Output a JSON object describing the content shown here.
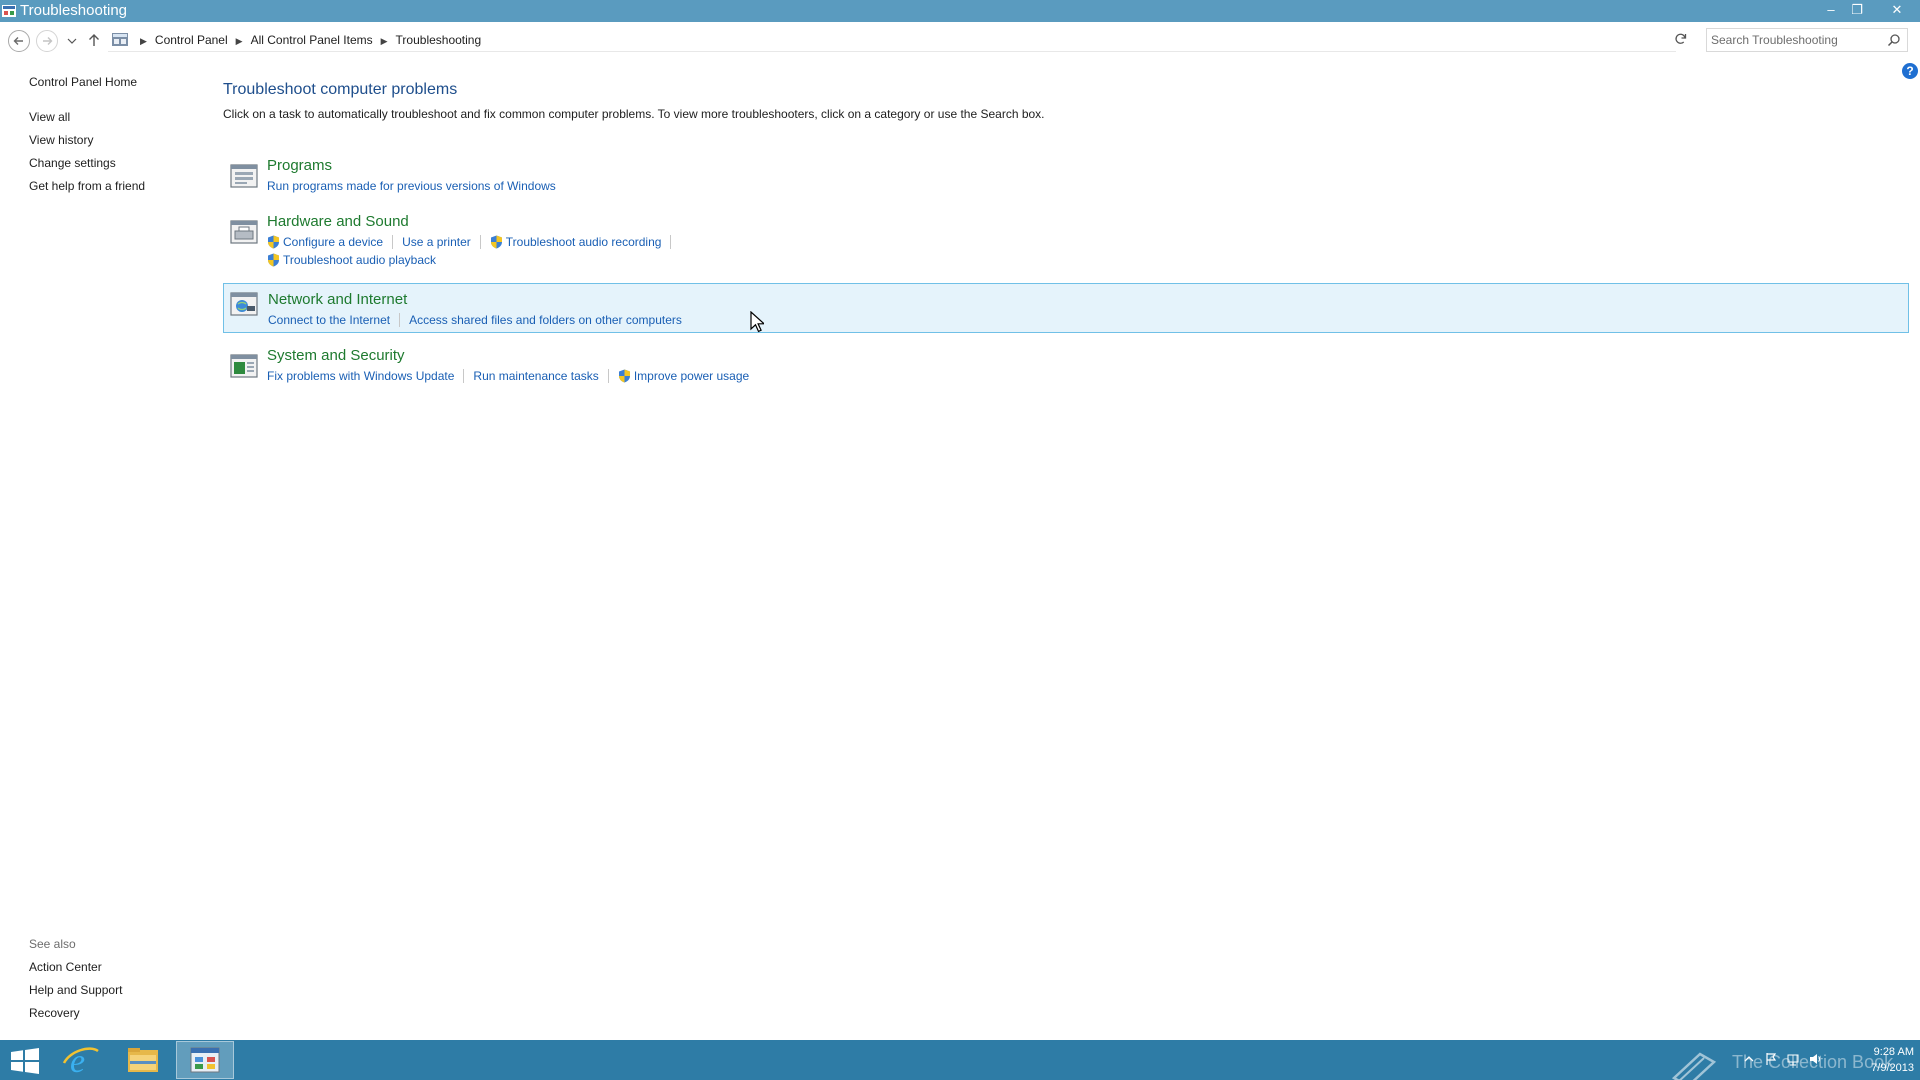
{
  "window": {
    "title": "Troubleshooting",
    "minimize": "–",
    "maximize": "❐",
    "close": "✕"
  },
  "address": {
    "crumbs": [
      "Control Panel",
      "All Control Panel Items",
      "Troubleshooting"
    ],
    "search_placeholder": "Search Troubleshooting"
  },
  "leftpane": {
    "home": "Control Panel Home",
    "links": [
      "View all",
      "View history",
      "Change settings",
      "Get help from a friend"
    ],
    "see_also_label": "See also",
    "see_also": [
      "Action Center",
      "Help and Support",
      "Recovery"
    ]
  },
  "main": {
    "title": "Troubleshoot computer problems",
    "description": "Click on a task to automatically troubleshoot and fix common computer problems. To view more troubleshooters, click on a category or use the Search box.",
    "categories": [
      {
        "title": "Programs",
        "icon": "programs-icon",
        "tasks": [
          {
            "label": "Run programs made for previous versions of Windows",
            "shield": false
          }
        ]
      },
      {
        "title": "Hardware and Sound",
        "icon": "hardware-sound-icon",
        "tasks": [
          {
            "label": "Configure a device",
            "shield": true
          },
          {
            "label": "Use a printer",
            "shield": false
          },
          {
            "label": "Troubleshoot audio recording",
            "shield": true
          },
          {
            "label": "Troubleshoot audio playback",
            "shield": true
          }
        ]
      },
      {
        "title": "Network and Internet",
        "icon": "network-internet-icon",
        "hovered": true,
        "tasks": [
          {
            "label": "Connect to the Internet",
            "shield": false
          },
          {
            "label": "Access shared files and folders on other computers",
            "shield": false
          }
        ]
      },
      {
        "title": "System and Security",
        "icon": "system-security-icon",
        "tasks": [
          {
            "label": "Fix problems with Windows Update",
            "shield": false
          },
          {
            "label": "Run maintenance tasks",
            "shield": false
          },
          {
            "label": "Improve power usage",
            "shield": true
          }
        ]
      }
    ]
  },
  "taskbar": {
    "watermark": "The Collection Book",
    "time": "9:28 AM",
    "date": "7/9/2013",
    "accent": "#2e7ca6"
  },
  "colors": {
    "titlebar": "#5a9bbf",
    "link": "#1a5fb4",
    "category_title": "#1e7a2f",
    "hover_bg": "#e5f3fb",
    "hover_border": "#70c0e7"
  }
}
